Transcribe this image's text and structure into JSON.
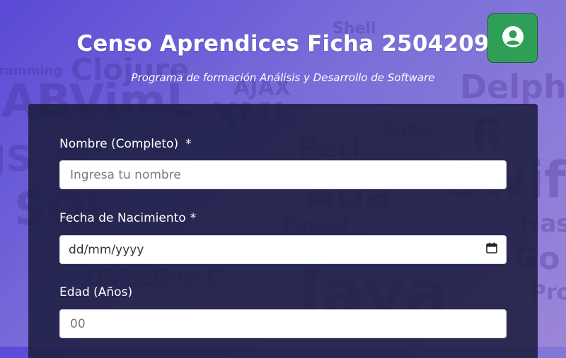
{
  "header": {
    "title": "Censo Aprendices Ficha 2504209",
    "subtitle": "Programa de formación Análisis y Desarrollo de Software"
  },
  "user_button": {
    "icon": "user-circle-icon",
    "color": "#2f9f57"
  },
  "background_words": [
    "ramming",
    "Clojure",
    "ABVimL",
    "XML",
    "Delph",
    "Perl",
    "Ada",
    "Swif",
    "Pascal",
    "Has",
    "Objective-C",
    "Java",
    "Go",
    "Pro",
    "Shell",
    "AJAX",
    "Cuda",
    "R",
    "SQL",
    "JS"
  ],
  "form": {
    "fields": [
      {
        "label": "Nombre (Completo)",
        "required_mark": "*",
        "placeholder": "Ingresa tu nombre"
      },
      {
        "label": "Fecha de Nacimiento",
        "required_mark": "*",
        "value_text": "dd/mm/yyyy",
        "icon": "calendar-icon"
      },
      {
        "label": "Edad (Años)",
        "placeholder": "00"
      }
    ]
  },
  "colors": {
    "card": "#1c1e40",
    "accent": "#2f9f57",
    "text": "#ffffff"
  }
}
